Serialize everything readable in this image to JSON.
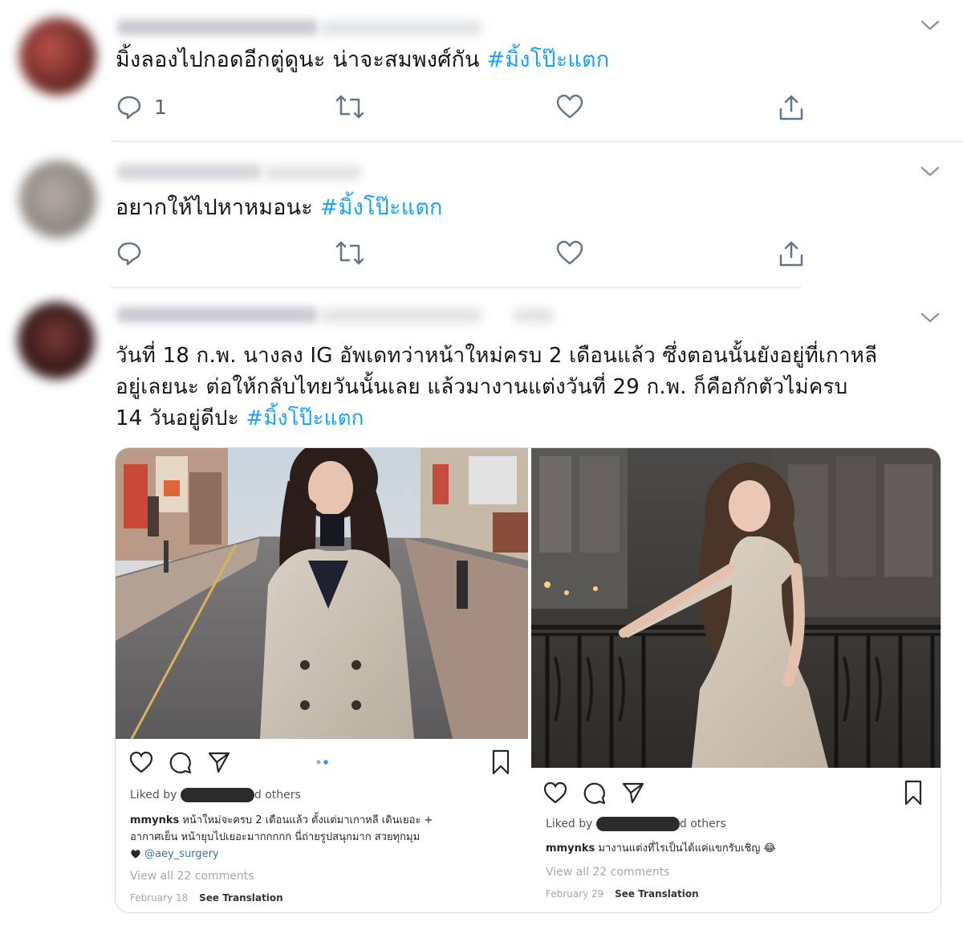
{
  "tweets": [
    {
      "text": "มิ้งลองไปกอดอีกตู่ดูนะ น่าจะสมพงศ์กัน ",
      "hashtag": "#มิ้งโป๊ะแตก",
      "reply_count": "1"
    },
    {
      "text": "อยากให้ไปหาหมอนะ ",
      "hashtag": "#มิ้งโป๊ะแตก",
      "reply_count": ""
    },
    {
      "text_line1": "วันที่ 18 ก.พ. นางลง IG อัพเดทว่าหน้าใหม่ครบ 2 เดือนแล้ว ซึ่งตอนนั้นยังอยู่ที่เกาหลี",
      "text_line2": "อยู่เลยนะ ต่อให้กลับไทยวันนั้นเลย แล้วมางานแต่งวันที่ 29 ก.พ. ก็คือกักตัวไม่ครบ",
      "text_line3": "14 วันอยู่ดีปะ ",
      "hashtag": "#มิ้งโป๊ะแตก",
      "reply_count": ""
    }
  ],
  "instagram_posts": [
    {
      "liked_prefix": "Liked by",
      "liked_suffix": "d others",
      "username": "mmynks",
      "caption_line1": "หน้าใหม่จะครบ 2 เดือนแล้ว ตั้งแต่มาเกาหลี เดินเยอะ +",
      "caption_line2": "อากาศเย็น หน้ายุบไปเยอะมากกกกก นี่ถ่ายรูปสนุกมาก สวยทุกมุม",
      "mention": "@aey_surgery",
      "view_comments": "View all 22 comments",
      "date": "February 18",
      "see_translation": "See Translation"
    },
    {
      "liked_prefix": "Liked by",
      "liked_suffix": "d others",
      "username": "mmynks",
      "caption_line1": "มางานแต่งที่ไรเป็นได้แค่แขกรับเชิญ 😂",
      "view_comments": "View all 22 comments",
      "date": "February 29",
      "see_translation": "See Translation"
    }
  ],
  "icons": [
    "chevron-down-icon",
    "reply-icon",
    "retweet-icon",
    "like-icon",
    "share-icon",
    "heart-icon",
    "comment-icon",
    "send-icon",
    "bookmark-icon",
    "heart-black-icon"
  ],
  "colors": {
    "hashtag": "#1da1f2",
    "action_gray": "#657786",
    "divider": "#e6ecf0",
    "ig_link": "#3f729b"
  }
}
